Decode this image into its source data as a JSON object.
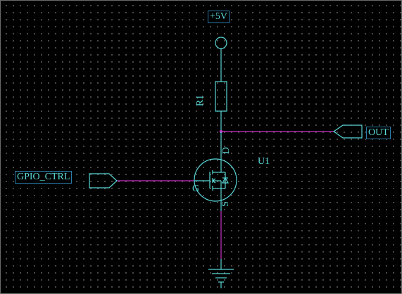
{
  "colors": {
    "background": "#000000",
    "grid_dot": "#8a8a8a",
    "component": "#5ad6d6",
    "wire": "#c832c8",
    "net_label": "#5ad6d6",
    "net_label_box": "#2a7aa8",
    "ref_text": "#5ad6d6"
  },
  "labels": {
    "power_net": "+5V",
    "resistor_ref": "R1",
    "output_net": "OUT",
    "gate_net": "GPIO_CTRL",
    "transistor_ref": "U1",
    "pin_drain": "D",
    "pin_gate": "G",
    "pin_source": "S"
  },
  "icons": {
    "power_port": "power-circle-icon",
    "resistor": "resistor-icon",
    "mosfet": "n-channel-mosfet-icon",
    "ground": "ground-icon",
    "output_port": "output-port-icon",
    "input_port": "input-port-icon"
  }
}
